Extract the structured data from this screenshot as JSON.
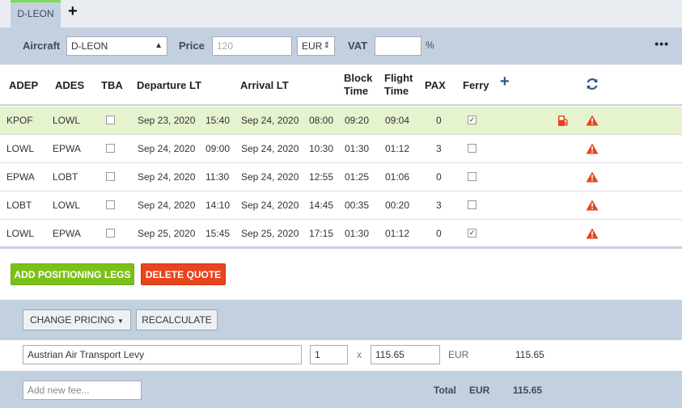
{
  "tabs": [
    {
      "label": "D-LEON"
    }
  ],
  "toolbar": {
    "aircraft_label": "Aircraft",
    "aircraft_value": "D-LEON",
    "price_label": "Price",
    "price_placeholder": "120",
    "currency_value": "EUR",
    "vat_label": "VAT",
    "vat_value": "",
    "percent": "%"
  },
  "table": {
    "headers": {
      "adep": "ADEP",
      "ades": "ADES",
      "tba": "TBA",
      "departure": "Departure LT",
      "arrival": "Arrival LT",
      "block1": "Block",
      "block2": "Time",
      "flight1": "Flight",
      "flight2": "Time",
      "pax": "PAX",
      "ferry": "Ferry"
    },
    "rows": [
      {
        "adep": "KPOF",
        "ades": "LOWL",
        "tba": false,
        "dep_date": "Sep 23, 2020",
        "dep_time": "15:40",
        "arr_date": "Sep 24, 2020",
        "arr_time": "08:00",
        "block": "09:20",
        "flight": "09:04",
        "pax": "0",
        "ferry": true,
        "fuel": true
      },
      {
        "adep": "LOWL",
        "ades": "EPWA",
        "tba": false,
        "dep_date": "Sep 24, 2020",
        "dep_time": "09:00",
        "arr_date": "Sep 24, 2020",
        "arr_time": "10:30",
        "block": "01:30",
        "flight": "01:12",
        "pax": "3",
        "ferry": false,
        "fuel": false
      },
      {
        "adep": "EPWA",
        "ades": "LOBT",
        "tba": false,
        "dep_date": "Sep 24, 2020",
        "dep_time": "11:30",
        "arr_date": "Sep 24, 2020",
        "arr_time": "12:55",
        "block": "01:25",
        "flight": "01:06",
        "pax": "0",
        "ferry": false,
        "fuel": false
      },
      {
        "adep": "LOBT",
        "ades": "LOWL",
        "tba": false,
        "dep_date": "Sep 24, 2020",
        "dep_time": "14:10",
        "arr_date": "Sep 24, 2020",
        "arr_time": "14:45",
        "block": "00:35",
        "flight": "00:20",
        "pax": "3",
        "ferry": false,
        "fuel": false
      },
      {
        "adep": "LOWL",
        "ades": "EPWA",
        "tba": false,
        "dep_date": "Sep 25, 2020",
        "dep_time": "15:45",
        "arr_date": "Sep 25, 2020",
        "arr_time": "17:15",
        "block": "01:30",
        "flight": "01:12",
        "pax": "0",
        "ferry": true,
        "fuel": false
      }
    ]
  },
  "actions": {
    "add_positioning": "ADD POSITIONING LEGS",
    "delete_quote": "DELETE QUOTE"
  },
  "pricing": {
    "change_pricing": "CHANGE PRICING",
    "recalculate": "RECALCULATE",
    "fee": {
      "name": "Austrian Air Transport Levy",
      "qty": "1",
      "x": "x",
      "unit_price": "115.65",
      "currency": "EUR",
      "amount": "115.65"
    },
    "new_fee_placeholder": "Add new fee...",
    "total_label": "Total",
    "total_currency": "EUR",
    "total_amount": "115.65"
  },
  "colors": {
    "accent_green": "#7cc118",
    "danger_red": "#e8441d",
    "toolbar_bg": "#c3d0df",
    "highlight_row": "#e5f3cf"
  }
}
